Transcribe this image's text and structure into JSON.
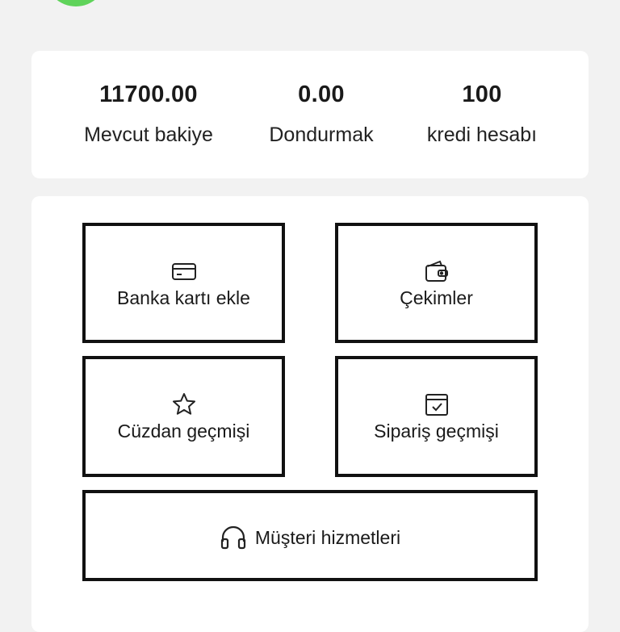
{
  "stats": [
    {
      "value": "11700.00",
      "label": "Mevcut bakiye"
    },
    {
      "value": "0.00",
      "label": "Dondurmak"
    },
    {
      "value": "100",
      "label": "kredi hesabı"
    }
  ],
  "menu": {
    "add_bank_card": {
      "label": "Banka kartı ekle",
      "icon": "credit-card-icon"
    },
    "withdrawals": {
      "label": "Çekimler",
      "icon": "wallet-icon"
    },
    "wallet_history": {
      "label": "Cüzdan geçmişi",
      "icon": "star-icon"
    },
    "order_history": {
      "label": "Sipariş geçmişi",
      "icon": "calendar-check-icon"
    },
    "customer_service": {
      "label": "Müşteri hizmetleri",
      "icon": "headphones-icon"
    }
  },
  "colors": {
    "background": "#f2f2f2",
    "card": "#ffffff",
    "border": "#111111",
    "avatar": "#5fd35a"
  }
}
